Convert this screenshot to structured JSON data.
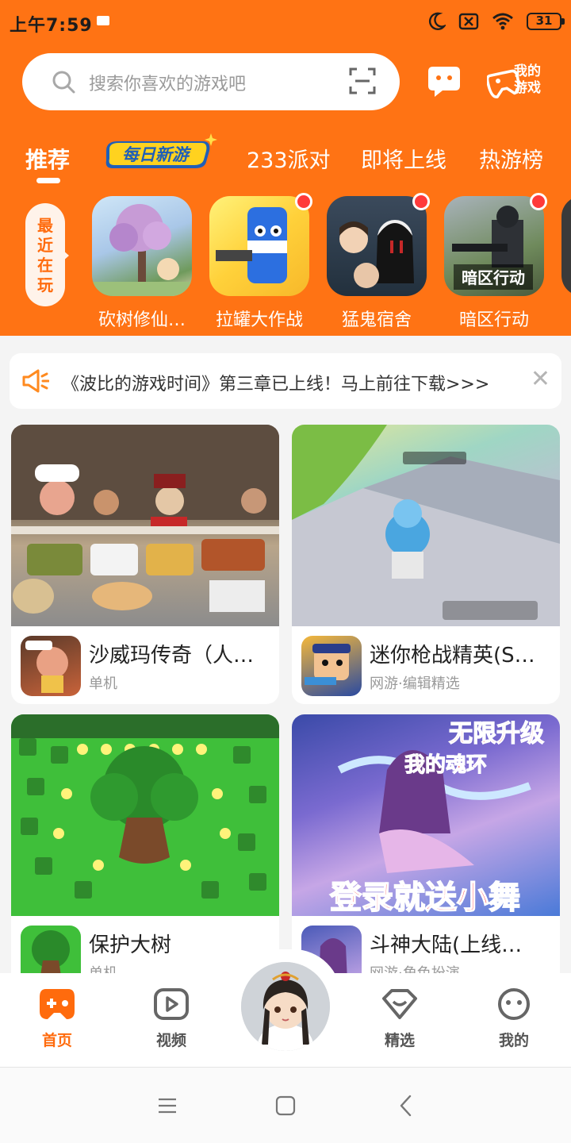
{
  "status_bar": {
    "time": "上午7:59",
    "battery": "31"
  },
  "search": {
    "placeholder": "搜索你喜欢的游戏吧"
  },
  "header": {
    "my_games_label": "我的游戏",
    "daily_new_label": "每日新游"
  },
  "tabs": [
    {
      "label": "推荐",
      "active": true
    },
    {
      "label": "233派对",
      "active": false
    },
    {
      "label": "即将上线",
      "active": false
    },
    {
      "label": "热游榜",
      "active": false
    }
  ],
  "recent": {
    "label": "最近在玩",
    "games": [
      {
        "name": "砍树修仙…",
        "badge": false
      },
      {
        "name": "拉罐大作战",
        "badge": true
      },
      {
        "name": "猛鬼宿舍",
        "badge": true
      },
      {
        "name": "暗区行动",
        "badge": true
      }
    ]
  },
  "notice": {
    "text": "《波比的游戏时间》第三章已上线！马上前往下载>>>"
  },
  "cards": [
    {
      "title": "沙威玛传奇（人…",
      "tag": "单机"
    },
    {
      "title": "迷你枪战精英(S…",
      "tag": "网游·编辑精选"
    },
    {
      "title": "保护大树",
      "tag": "单机"
    },
    {
      "title": "斗神大陆(上线…",
      "tag": "网游·角色扮演",
      "banner_top": "无限升级",
      "banner_mid": "我的魂环",
      "banner_bottom": "登录就送小舞"
    }
  ],
  "bottom_nav": [
    {
      "label": "首页",
      "active": true
    },
    {
      "label": "视频",
      "active": false
    },
    {
      "label": "精选",
      "active": false
    },
    {
      "label": "我的",
      "active": false
    }
  ],
  "colors": {
    "brand": "#ff7314",
    "accent_text": "#ff6b0d"
  }
}
